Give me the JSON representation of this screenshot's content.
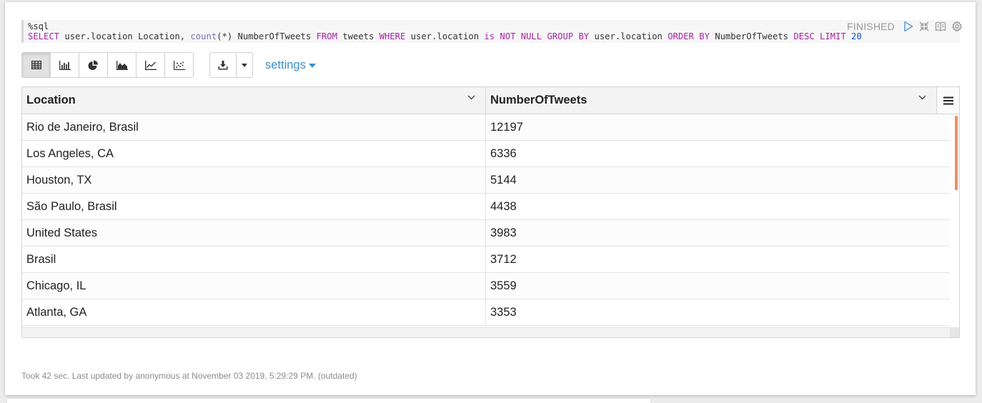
{
  "editor": {
    "magic": "%sql",
    "query_tokens": [
      {
        "t": "SELECT",
        "c": "kw"
      },
      {
        "t": " user.location Location, ",
        "c": ""
      },
      {
        "t": "count",
        "c": "fn"
      },
      {
        "t": "(*) NumberOfTweets ",
        "c": ""
      },
      {
        "t": "FROM",
        "c": "kw"
      },
      {
        "t": " tweets ",
        "c": ""
      },
      {
        "t": "WHERE",
        "c": "kw"
      },
      {
        "t": " user.location ",
        "c": ""
      },
      {
        "t": "is NOT NULL GROUP BY",
        "c": "kw"
      },
      {
        "t": " user.location ",
        "c": ""
      },
      {
        "t": "ORDER BY",
        "c": "kw"
      },
      {
        "t": " NumberOfTweets ",
        "c": ""
      },
      {
        "t": "DESC LIMIT",
        "c": "kw"
      },
      {
        "t": " ",
        "c": ""
      },
      {
        "t": "20",
        "c": "num"
      }
    ]
  },
  "status": {
    "label": "FINISHED",
    "icons": [
      "run-icon",
      "collapse-icon",
      "book-icon",
      "gear-icon"
    ]
  },
  "toolbar": {
    "views": [
      {
        "name": "table-view-button",
        "icon": "table-icon",
        "active": true
      },
      {
        "name": "bar-chart-button",
        "icon": "bar-chart-icon",
        "active": false
      },
      {
        "name": "pie-chart-button",
        "icon": "pie-chart-icon",
        "active": false
      },
      {
        "name": "area-chart-button",
        "icon": "area-chart-icon",
        "active": false
      },
      {
        "name": "line-chart-button",
        "icon": "line-chart-icon",
        "active": false
      },
      {
        "name": "scatter-chart-button",
        "icon": "scatter-chart-icon",
        "active": false
      }
    ],
    "settings_label": "settings"
  },
  "table": {
    "columns": [
      "Location",
      "NumberOfTweets"
    ],
    "rows": [
      [
        "Rio de Janeiro, Brasil",
        "12197"
      ],
      [
        "Los Angeles, CA",
        "6336"
      ],
      [
        "Houston, TX",
        "5144"
      ],
      [
        "São Paulo, Brasil",
        "4438"
      ],
      [
        "United States",
        "3983"
      ],
      [
        "Brasil",
        "3712"
      ],
      [
        "Chicago, IL",
        "3559"
      ],
      [
        "Atlanta, GA",
        "3353"
      ]
    ]
  },
  "footer": {
    "text": "Took 42 sec. Last updated by anonymous at November 03 2019, 5:29:29 PM. (outdated)"
  },
  "colors": {
    "accent": "#3c8dca",
    "scroll_thumb": "#ef8d64",
    "keyword": "#a626a4",
    "number": "#0b56c9"
  }
}
